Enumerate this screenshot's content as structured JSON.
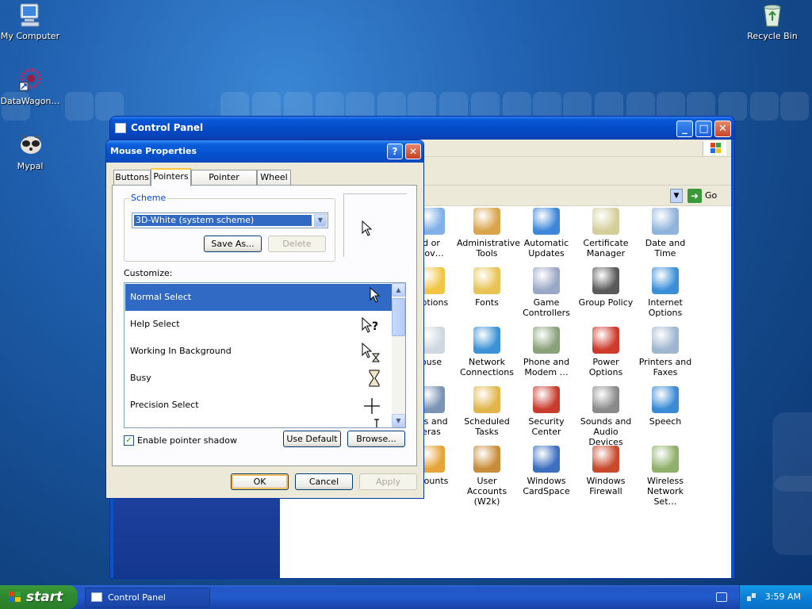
{
  "desktop": {
    "icons": [
      {
        "label": "My Computer"
      },
      {
        "label": "DataWagon…"
      },
      {
        "label": "Mypal"
      },
      {
        "label": "Recycle Bin"
      }
    ]
  },
  "control_panel": {
    "title": "Control Panel",
    "go_label": "Go",
    "items": [
      {
        "label": "d or\nnov…"
      },
      {
        "label": "Administrative\nTools"
      },
      {
        "label": "Automatic\nUpdates"
      },
      {
        "label": "Certificate\nManager"
      },
      {
        "label": "Date and Time"
      },
      {
        "label": "Options"
      },
      {
        "label": "Fonts"
      },
      {
        "label": "Game\nControllers"
      },
      {
        "label": "Group Policy"
      },
      {
        "label": "Internet\nOptions"
      },
      {
        "label": "ouse"
      },
      {
        "label": "Network\nConnections"
      },
      {
        "label": "Phone and\nModem …"
      },
      {
        "label": "Power Options"
      },
      {
        "label": "Printers and\nFaxes"
      },
      {
        "label": "ers and\neras"
      },
      {
        "label": "Scheduled\nTasks"
      },
      {
        "label": "Security\nCenter"
      },
      {
        "label": "Sounds and\nAudio Devices"
      },
      {
        "label": "Speech"
      },
      {
        "label": "ccounts"
      },
      {
        "label": "User Accounts\n(W2k)"
      },
      {
        "label": "Windows\nCardSpace"
      },
      {
        "label": "Windows\nFirewall"
      },
      {
        "label": "Wireless\nNetwork Set…"
      }
    ]
  },
  "dialog": {
    "title": "Mouse Properties",
    "help_label": "?",
    "close_label": "✕",
    "tabs": [
      {
        "label": "Buttons"
      },
      {
        "label": "Pointers"
      },
      {
        "label": "Pointer Options"
      },
      {
        "label": "Wheel"
      }
    ],
    "active_tab": "Pointers",
    "scheme_legend": "Scheme",
    "scheme_value": "3D-White (system scheme)",
    "save_as_label": "Save As...",
    "delete_label": "Delete",
    "customize_label": "Customize:",
    "pointers": [
      {
        "label": "Normal Select",
        "cursor": "arrow-cursor"
      },
      {
        "label": "Help Select",
        "cursor": "help-cursor"
      },
      {
        "label": "Working In Background",
        "cursor": "working-cursor"
      },
      {
        "label": "Busy",
        "cursor": "hourglass-cursor"
      },
      {
        "label": "Precision Select",
        "cursor": "crosshair-cursor"
      }
    ],
    "selected_pointer": "Normal Select",
    "shadow_label": "Enable pointer shadow",
    "shadow_checked": true,
    "use_default_label": "Use Default",
    "browse_label": "Browse...",
    "ok_label": "OK",
    "cancel_label": "Cancel",
    "apply_label": "Apply"
  },
  "taskbar": {
    "start_label": "start",
    "tasks": [
      {
        "label": "Control Panel"
      }
    ],
    "clock": "3:59 AM"
  }
}
